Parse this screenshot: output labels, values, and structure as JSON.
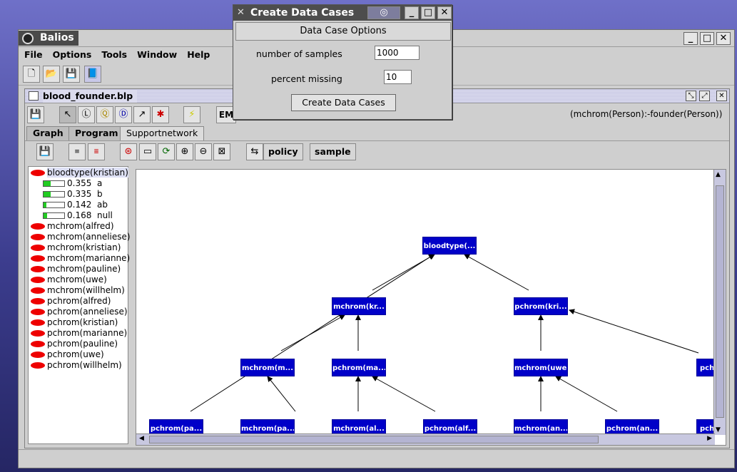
{
  "main_window": {
    "title": "Balios",
    "menu": [
      "File",
      "Options",
      "Tools",
      "Window",
      "Help"
    ]
  },
  "inner_frame": {
    "title": "blood_founder.blp",
    "em_label": "EM",
    "clause": "(mchrom(Person):-founder(Person))",
    "tabs": [
      "Graph",
      "Program",
      "Supportnetwork"
    ],
    "active_tab": "Supportnetwork",
    "policy_label": "policy",
    "sample_label": "sample"
  },
  "tree": {
    "selected": "bloodtype(kristian)",
    "probabilities": [
      {
        "value": "0.355",
        "label": "a",
        "fraction": 0.355
      },
      {
        "value": "0.335",
        "label": "b",
        "fraction": 0.335
      },
      {
        "value": "0.142",
        "label": "ab",
        "fraction": 0.142
      },
      {
        "value": "0.168",
        "label": "null",
        "fraction": 0.168
      }
    ],
    "items": [
      "mchrom(alfred)",
      "mchrom(anneliese)",
      "mchrom(kristian)",
      "mchrom(marianne)",
      "mchrom(pauline)",
      "mchrom(uwe)",
      "mchrom(willhelm)",
      "pchrom(alfred)",
      "pchrom(anneliese)",
      "pchrom(kristian)",
      "pchrom(marianne)",
      "pchrom(pauline)",
      "pchrom(uwe)",
      "pchrom(willhelm)"
    ]
  },
  "graph": {
    "nodes": {
      "root": "bloodtype(...",
      "l1a": "mchrom(kr...",
      "l1b": "pchrom(kri...",
      "l2a": "mchrom(m...",
      "l2b": "pchrom(ma...",
      "l2c": "mchrom(uwe)",
      "l2d": "pch",
      "l3a": "pchrom(pa...",
      "l3b": "mchrom(pa...",
      "l3c": "mchrom(al...",
      "l3d": "pchrom(alf...",
      "l3e": "mchrom(an...",
      "l3f": "pchrom(an...",
      "l3g": "pch"
    }
  },
  "dialog": {
    "title": "Create Data Cases",
    "panel_title": "Data Case Options",
    "samples_label": "number of samples",
    "samples_value": "1000",
    "missing_label": "percent missing",
    "missing_value": "10",
    "button": "Create Data Cases"
  }
}
